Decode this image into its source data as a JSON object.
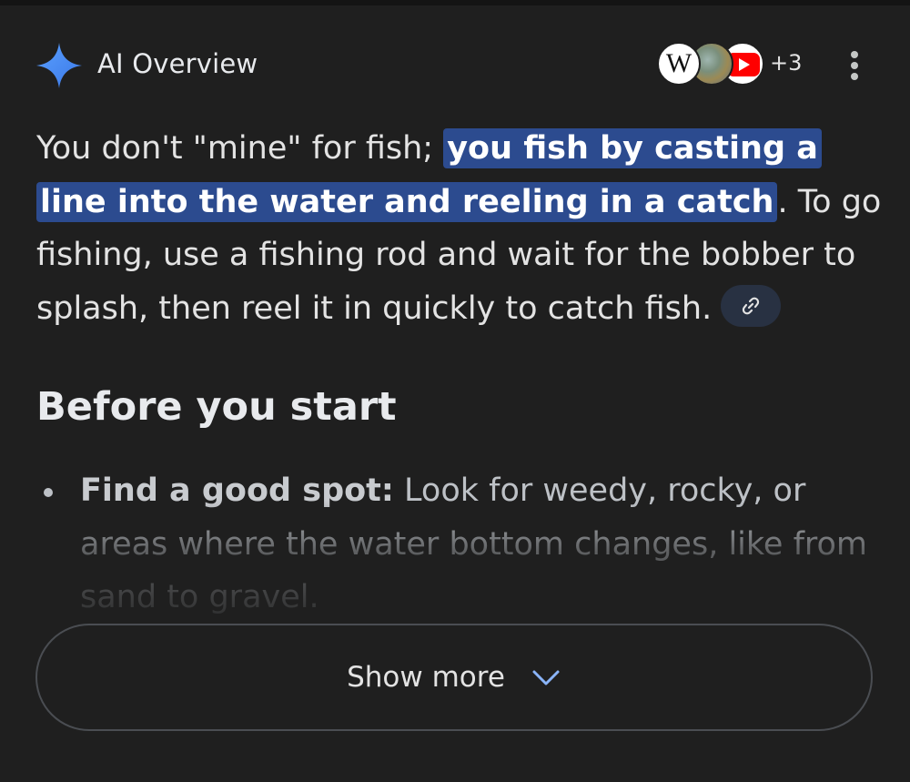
{
  "header": {
    "title": "AI Overview",
    "sources_extra_count": "+3",
    "source_icons": [
      "wikipedia-icon",
      "globe-icon",
      "youtube-icon"
    ],
    "menu_icon": "more-vert-icon"
  },
  "overview": {
    "text_before": "You don't \"mine\" for fish; ",
    "highlight": "you fish by casting a line into the water and reeling in a catch",
    "text_after": ". To go fishing, use a fishing rod and wait for the bobber to splash, then reel it in quickly to catch fish.",
    "link_icon": "link-icon"
  },
  "section": {
    "heading": "Before you start",
    "bullets": [
      {
        "title": "Find a good spot:",
        "text": " Look for weedy, rocky, or areas where the water bottom changes, like from sand to gravel."
      }
    ]
  },
  "show_more": {
    "label": "Show more",
    "icon": "chevron-down-icon"
  },
  "colors": {
    "background": "#1f1f1f",
    "highlight": "#2c4b8f",
    "sparkle_blue": "#4c8df6",
    "chip": "#283142"
  }
}
